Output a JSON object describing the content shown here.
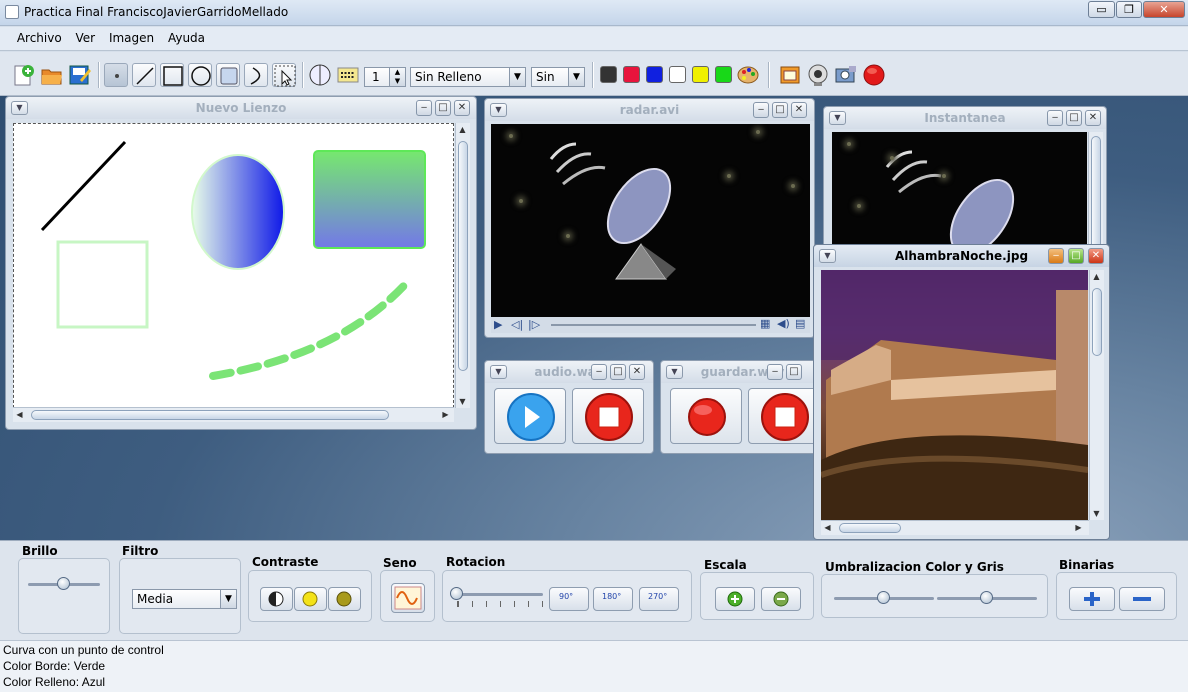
{
  "window": {
    "title": "Practica Final FranciscoJavierGarridoMellado",
    "minimize": "▭",
    "restore": "❐",
    "close": "✕"
  },
  "menu": [
    "Archivo",
    "Ver",
    "Imagen",
    "Ayuda"
  ],
  "toolbar": {
    "stroke_width": "1",
    "fill_mode": "Sin Relleno",
    "smooth_mode": "Sin",
    "colors": [
      "#333333",
      "#e8143c",
      "#1020e0",
      "#ffffff",
      "#f0f000",
      "#18d818"
    ]
  },
  "frames": {
    "lienzo": {
      "title": "Nuevo Lienzo"
    },
    "radar": {
      "title": "radar.avi"
    },
    "instantanea": {
      "title": "Instantanea"
    },
    "alhambra": {
      "title": "AlhambraNoche.jpg"
    },
    "audio": {
      "title": "audio.wav"
    },
    "guardar": {
      "title": "guardar.wav"
    }
  },
  "panel": {
    "brillo": {
      "label": "Brillo",
      "value": 0.5
    },
    "filtro": {
      "label": "Filtro",
      "selected": "Media"
    },
    "contraste": {
      "label": "Contraste"
    },
    "seno": {
      "label": "Seno"
    },
    "rotacion": {
      "label": "Rotacion",
      "value": 0,
      "b90": "90°",
      "b180": "180°",
      "b270": "270°"
    },
    "escala": {
      "label": "Escala"
    },
    "umbral": {
      "label": "Umbralizacion Color y Gris",
      "color_value": 0.5,
      "gris_value": 0.5
    },
    "binarias": {
      "label": "Binarias"
    }
  },
  "status": {
    "line1": "Curva con un punto de control",
    "line2": "Color Borde: Verde",
    "line3": "Color Relleno: Azul"
  }
}
